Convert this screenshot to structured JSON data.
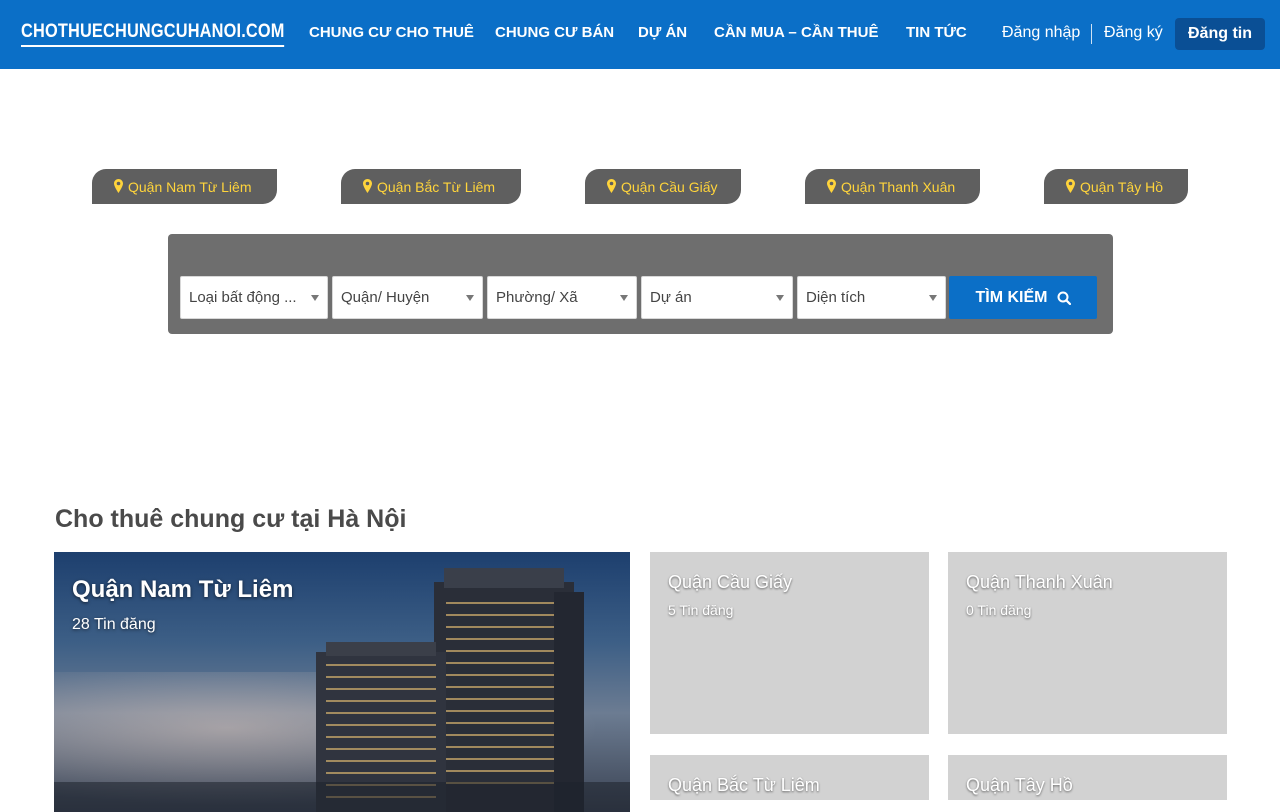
{
  "header": {
    "logo_text": "CHOTHUECHUNGCUHANOI.COM",
    "logo_icon": "building-icon",
    "nav": [
      {
        "label": "CHUNG CƯ CHO THUÊ"
      },
      {
        "label": "CHUNG CƯ BÁN"
      },
      {
        "label": "DỰ ÁN"
      },
      {
        "label": "CẦN MUA – CẦN THUÊ"
      },
      {
        "label": "TIN TỨC"
      }
    ],
    "login": "Đăng nhập",
    "register": "Đăng ký",
    "post": "Đăng tin",
    "colors": {
      "bar": "#0b6fc7",
      "post_button": "#0a4f95"
    }
  },
  "district_tabs": [
    {
      "label": "Quận Nam Từ Liêm",
      "icon": "map-marker-icon"
    },
    {
      "label": "Quận Bắc Từ Liêm",
      "icon": "map-marker-icon"
    },
    {
      "label": "Quận Cầu Giấy",
      "icon": "map-marker-icon"
    },
    {
      "label": "Quận Thanh Xuân",
      "icon": "map-marker-icon"
    },
    {
      "label": "Quận Tây Hồ",
      "icon": "map-marker-icon"
    }
  ],
  "search": {
    "filters": [
      {
        "selected": "Loại bất động ..."
      },
      {
        "selected": "Quận/ Huyện"
      },
      {
        "selected": "Phường/ Xã"
      },
      {
        "selected": "Dự án"
      },
      {
        "selected": "Diện tích"
      }
    ],
    "button": "TÌM KIẾM",
    "button_icon": "search-icon"
  },
  "section": {
    "title": "Cho thuê chung cư tại Hà Nội",
    "featured": {
      "name": "Quận Nam Từ Liêm",
      "count": "28 Tin đăng"
    },
    "cards": [
      {
        "name": "Quận Cầu Giấy",
        "count": "5 Tin đăng"
      },
      {
        "name": "Quận Thanh Xuân",
        "count": "0 Tin đăng"
      },
      {
        "name": "Quận Bắc Từ Liêm",
        "count": ""
      },
      {
        "name": "Quận Tây Hồ",
        "count": ""
      }
    ]
  }
}
